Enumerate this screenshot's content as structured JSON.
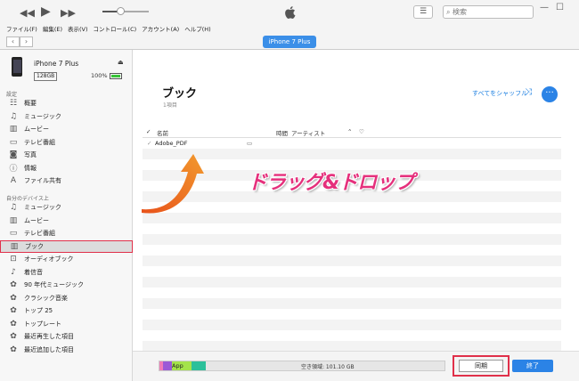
{
  "titlebar": {
    "search_placeholder": "検索"
  },
  "menu": [
    "ファイル(F)",
    "編集(E)",
    "表示(V)",
    "コントロール(C)",
    "アカウント(A)",
    "ヘルプ(H)"
  ],
  "nav": {
    "device_pill": "iPhone 7 Plus"
  },
  "device": {
    "name": "iPhone 7 Plus",
    "capacity": "128GB",
    "battery": "100%"
  },
  "sidebar": {
    "settings_heading": "設定",
    "settings_items": [
      {
        "label": "概要",
        "icon": "summary-icon"
      },
      {
        "label": "ミュージック",
        "icon": "music-note-icon"
      },
      {
        "label": "ムービー",
        "icon": "film-icon"
      },
      {
        "label": "テレビ番組",
        "icon": "tv-icon"
      },
      {
        "label": "写真",
        "icon": "camera-icon"
      },
      {
        "label": "情報",
        "icon": "info-icon"
      },
      {
        "label": "ファイル共有",
        "icon": "apps-icon"
      }
    ],
    "device_heading": "自分のデバイス上",
    "device_items": [
      {
        "label": "ミュージック",
        "icon": "music-note-icon"
      },
      {
        "label": "ムービー",
        "icon": "film-icon"
      },
      {
        "label": "テレビ番組",
        "icon": "tv-icon"
      },
      {
        "label": "ブック",
        "icon": "book-icon",
        "selected": true
      },
      {
        "label": "オーディオブック",
        "icon": "audiobook-icon"
      },
      {
        "label": "着信音",
        "icon": "bell-icon"
      },
      {
        "label": "90 年代ミュージック",
        "icon": "gear-icon"
      },
      {
        "label": "クラシック音楽",
        "icon": "gear-icon"
      },
      {
        "label": "トップ 25",
        "icon": "gear-icon"
      },
      {
        "label": "トップレート",
        "icon": "gear-icon"
      },
      {
        "label": "最近再生した項目",
        "icon": "gear-icon"
      },
      {
        "label": "最近追加した項目",
        "icon": "gear-icon"
      }
    ]
  },
  "main": {
    "title": "ブック",
    "count": "1項目",
    "shuffle_label": "すべてをシャッフル",
    "columns": {
      "name": "名前",
      "time": "時間",
      "artist": "アーティスト"
    },
    "rows": [
      {
        "name": "Adobe_PDF"
      }
    ]
  },
  "annotation": {
    "text": "ドラッグ&ドロップ"
  },
  "footer": {
    "app_label": "App",
    "free_label": "空き領域: 101.10 GB",
    "sync_label": "同期",
    "done_label": "終了"
  },
  "colors": {
    "accent": "#2b83e6",
    "highlight": "#e0304a",
    "annotation": "#e5307c"
  }
}
